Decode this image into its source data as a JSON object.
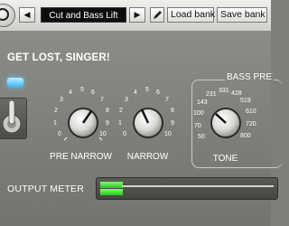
{
  "toolbar": {
    "preset_name": "Cut and Bass Lift",
    "prev_icon": "◀",
    "next_icon": "▶",
    "load_label": "Load bank",
    "save_label": "Save bank"
  },
  "brand": {
    "text": "GET LOST, SINGER!"
  },
  "knobs": {
    "pre_narrow": {
      "label": "PRE NARROW",
      "scale": [
        "0",
        "1",
        "2",
        "3",
        "4",
        "5",
        "6",
        "7",
        "8",
        "9",
        "10"
      ]
    },
    "narrow": {
      "label": "NARROW",
      "scale": [
        "0",
        "1",
        "2",
        "3",
        "4",
        "5",
        "6",
        "7",
        "8",
        "9",
        "10"
      ]
    },
    "tone": {
      "group_label": "BASS PRE",
      "label": "TONE",
      "scale": [
        "50",
        "70",
        "100",
        "143",
        "231",
        "331",
        "428",
        "519",
        "610",
        "720",
        "800"
      ]
    }
  },
  "meter": {
    "label": "OUTPUT METER",
    "left_level": 0.13,
    "right_level": 0.13
  },
  "colors": {
    "led": "#3eb6ff",
    "meter_green": "#39d52c",
    "display_bg": "#0d0d0d"
  }
}
